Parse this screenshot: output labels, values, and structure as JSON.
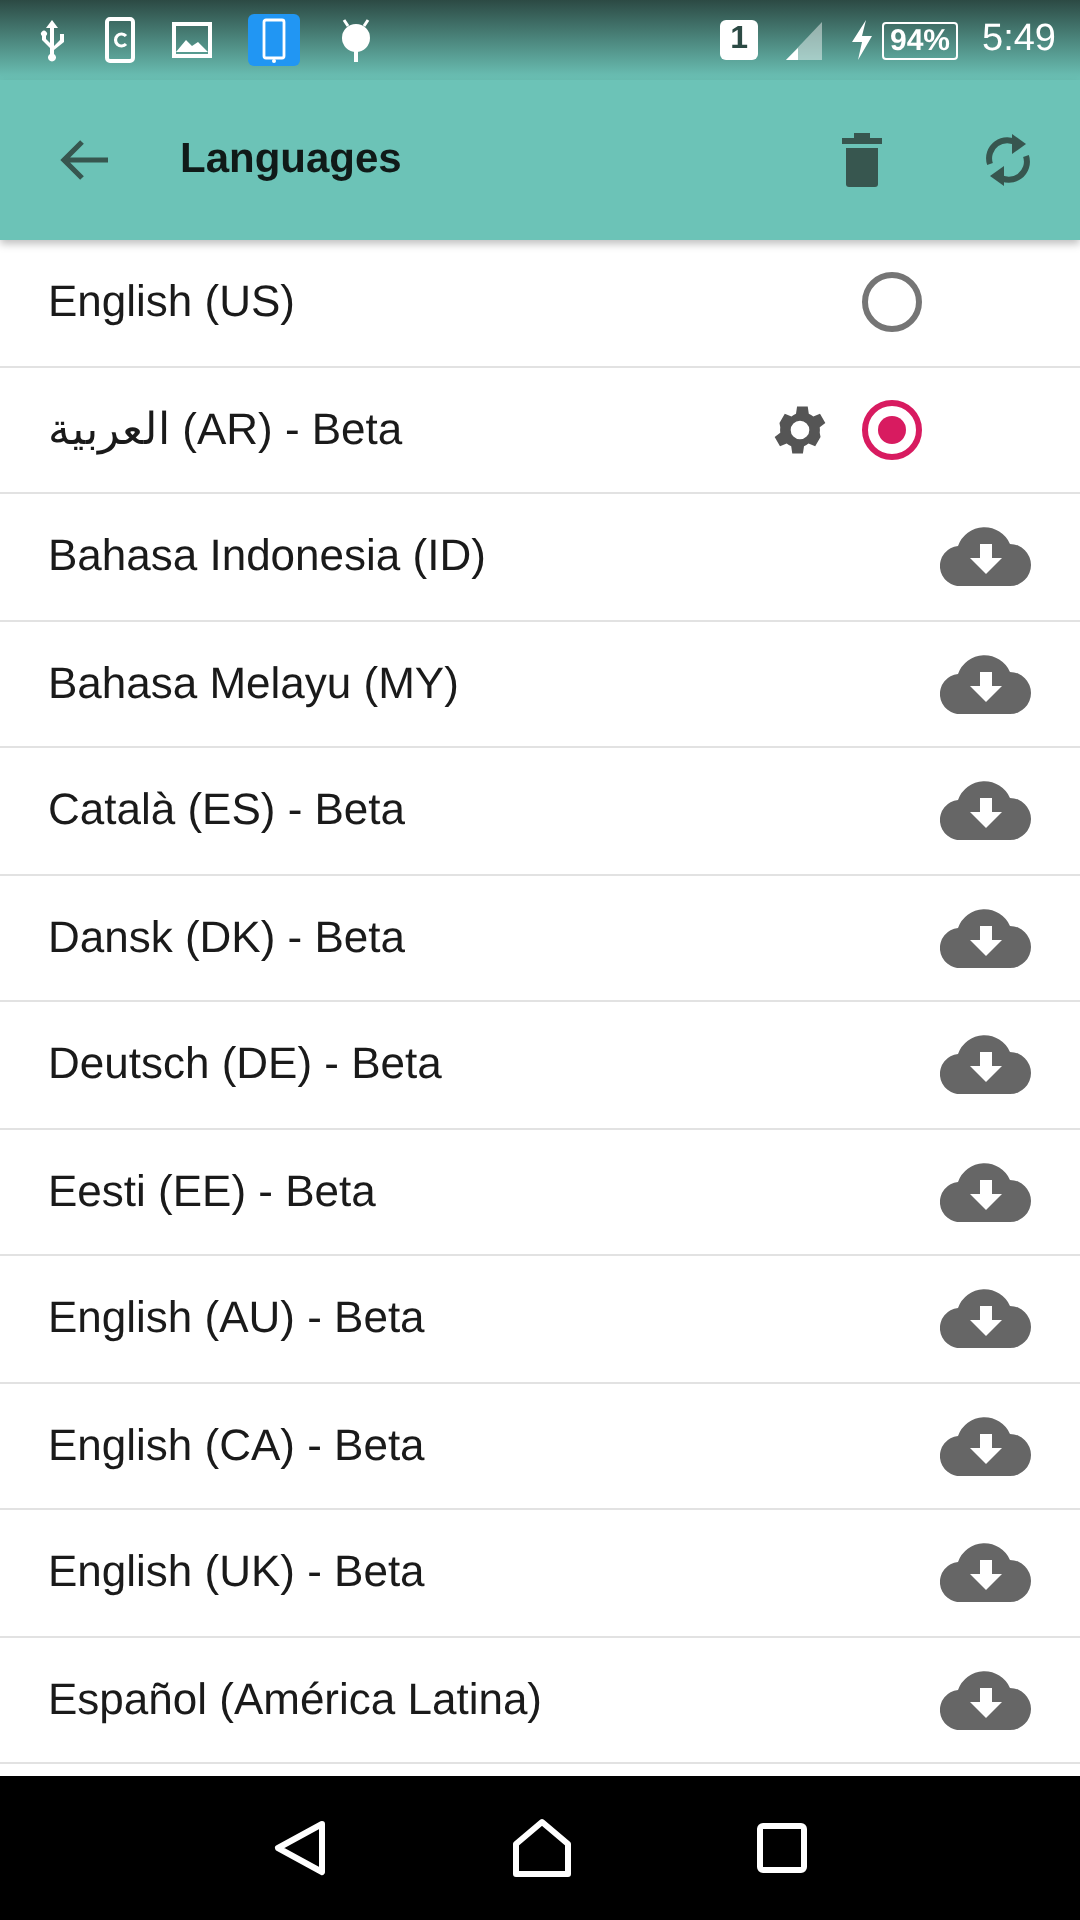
{
  "status_bar": {
    "sim": "1",
    "battery": "94%",
    "time": "5:49"
  },
  "app_bar": {
    "title": "Languages"
  },
  "languages": [
    {
      "name": "English (US)",
      "kind": "radio",
      "selected": false,
      "settings": false
    },
    {
      "name": "العربية (AR) - Beta",
      "kind": "radio",
      "selected": true,
      "settings": true
    },
    {
      "name": "Bahasa Indonesia (ID)",
      "kind": "download"
    },
    {
      "name": "Bahasa Melayu (MY)",
      "kind": "download"
    },
    {
      "name": "Català (ES) - Beta",
      "kind": "download"
    },
    {
      "name": "Dansk (DK) - Beta",
      "kind": "download"
    },
    {
      "name": "Deutsch (DE) - Beta",
      "kind": "download"
    },
    {
      "name": "Eesti (EE) - Beta",
      "kind": "download"
    },
    {
      "name": "English (AU) - Beta",
      "kind": "download"
    },
    {
      "name": "English (CA) - Beta",
      "kind": "download"
    },
    {
      "name": "English (UK) - Beta",
      "kind": "download"
    },
    {
      "name": "Español (América Latina)",
      "kind": "download"
    }
  ]
}
